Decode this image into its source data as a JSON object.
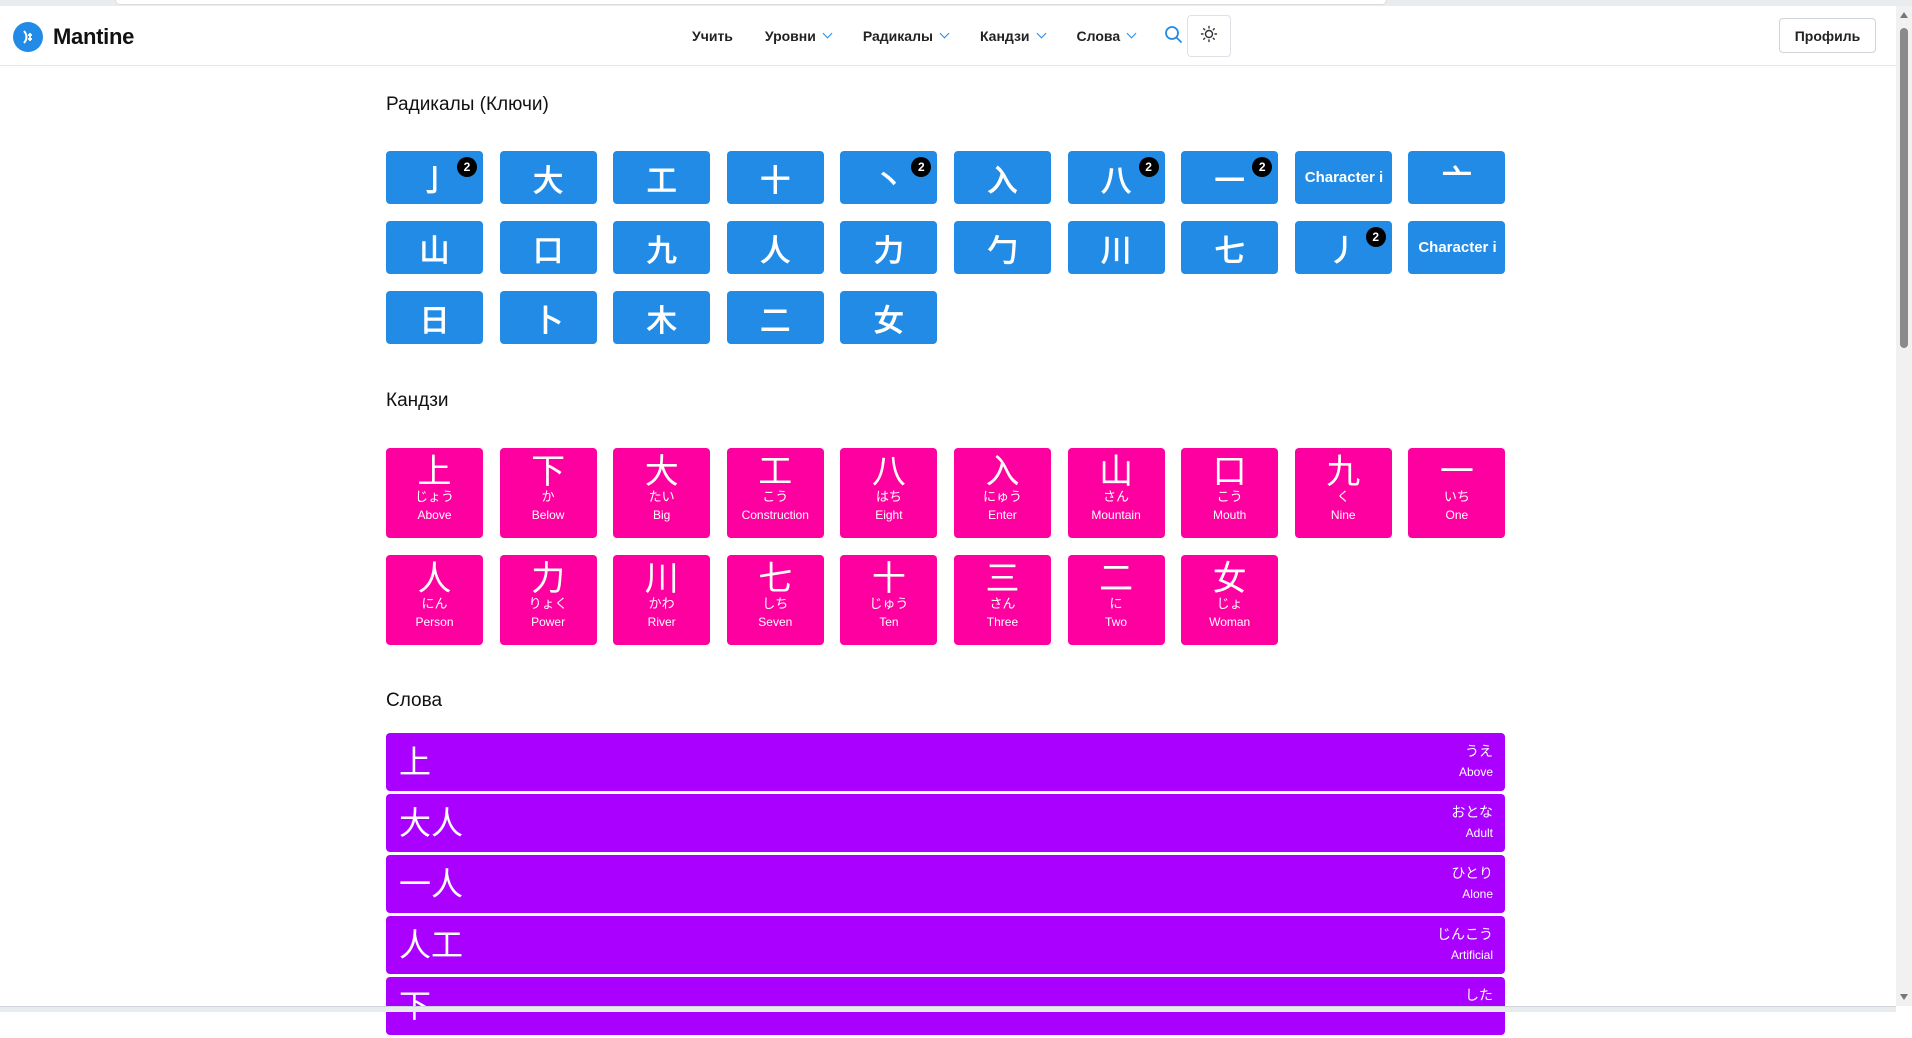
{
  "app": {
    "logo_text": "Mantine"
  },
  "nav": {
    "items": [
      {
        "label": "Учить",
        "dropdown": false
      },
      {
        "label": "Уровни",
        "dropdown": true
      },
      {
        "label": "Радикалы",
        "dropdown": true
      },
      {
        "label": "Кандзи",
        "dropdown": true
      },
      {
        "label": "Слова",
        "dropdown": true
      }
    ],
    "profile_label": "Профиль"
  },
  "colors": {
    "radical": "#228be6",
    "kanji": "#ff00a0",
    "word": "#aa00ff",
    "accent": "#228be6"
  },
  "icons": {
    "logo": "mantine-logo-icon",
    "search": "search-icon",
    "theme": "sun-icon",
    "chevron": "chevron-down-icon"
  },
  "sections": {
    "radicals_title": "Радикалы (Ключи)",
    "kanji_title": "Кандзи",
    "words_title": "Слова"
  },
  "radicals": [
    {
      "char": "亅",
      "badge": "2"
    },
    {
      "char": "大",
      "badge": ""
    },
    {
      "char": "工",
      "badge": ""
    },
    {
      "char": "十",
      "badge": ""
    },
    {
      "char": "丶",
      "badge": "2"
    },
    {
      "char": "入",
      "badge": ""
    },
    {
      "char": "八",
      "badge": "2"
    },
    {
      "char": "一",
      "badge": "2"
    },
    {
      "char": "Character i",
      "badge": "",
      "text": true
    },
    {
      "char": "亠",
      "badge": ""
    },
    {
      "char": "山",
      "badge": ""
    },
    {
      "char": "口",
      "badge": ""
    },
    {
      "char": "九",
      "badge": ""
    },
    {
      "char": "人",
      "badge": ""
    },
    {
      "char": "力",
      "badge": ""
    },
    {
      "char": "勹",
      "badge": ""
    },
    {
      "char": "川",
      "badge": ""
    },
    {
      "char": "七",
      "badge": ""
    },
    {
      "char": "丿",
      "badge": "2"
    },
    {
      "char": "Character i",
      "badge": "",
      "text": true
    },
    {
      "char": "日",
      "badge": ""
    },
    {
      "char": "卜",
      "badge": ""
    },
    {
      "char": "木",
      "badge": ""
    },
    {
      "char": "二",
      "badge": ""
    },
    {
      "char": "女",
      "badge": ""
    }
  ],
  "kanji": [
    {
      "char": "上",
      "reading": "じょう",
      "meaning": "Above"
    },
    {
      "char": "下",
      "reading": "か",
      "meaning": "Below"
    },
    {
      "char": "大",
      "reading": "たい",
      "meaning": "Big"
    },
    {
      "char": "工",
      "reading": "こう",
      "meaning": "Construction"
    },
    {
      "char": "八",
      "reading": "はち",
      "meaning": "Eight"
    },
    {
      "char": "入",
      "reading": "にゅう",
      "meaning": "Enter"
    },
    {
      "char": "山",
      "reading": "さん",
      "meaning": "Mountain"
    },
    {
      "char": "口",
      "reading": "こう",
      "meaning": "Mouth"
    },
    {
      "char": "九",
      "reading": "く",
      "meaning": "Nine"
    },
    {
      "char": "一",
      "reading": "いち",
      "meaning": "One"
    },
    {
      "char": "人",
      "reading": "にん",
      "meaning": "Person"
    },
    {
      "char": "力",
      "reading": "りょく",
      "meaning": "Power"
    },
    {
      "char": "川",
      "reading": "かわ",
      "meaning": "River"
    },
    {
      "char": "七",
      "reading": "しち",
      "meaning": "Seven"
    },
    {
      "char": "十",
      "reading": "じゅう",
      "meaning": "Ten"
    },
    {
      "char": "三",
      "reading": "さん",
      "meaning": "Three"
    },
    {
      "char": "二",
      "reading": "に",
      "meaning": "Two"
    },
    {
      "char": "女",
      "reading": "じょ",
      "meaning": "Woman"
    }
  ],
  "words": [
    {
      "word": "上",
      "reading": "うえ",
      "meaning": "Above"
    },
    {
      "word": "大人",
      "reading": "おとな",
      "meaning": "Adult"
    },
    {
      "word": "一人",
      "reading": "ひとり",
      "meaning": "Alone"
    },
    {
      "word": "人工",
      "reading": "じんこう",
      "meaning": "Artificial"
    },
    {
      "word": "下",
      "reading": "した",
      "meaning": ""
    }
  ]
}
